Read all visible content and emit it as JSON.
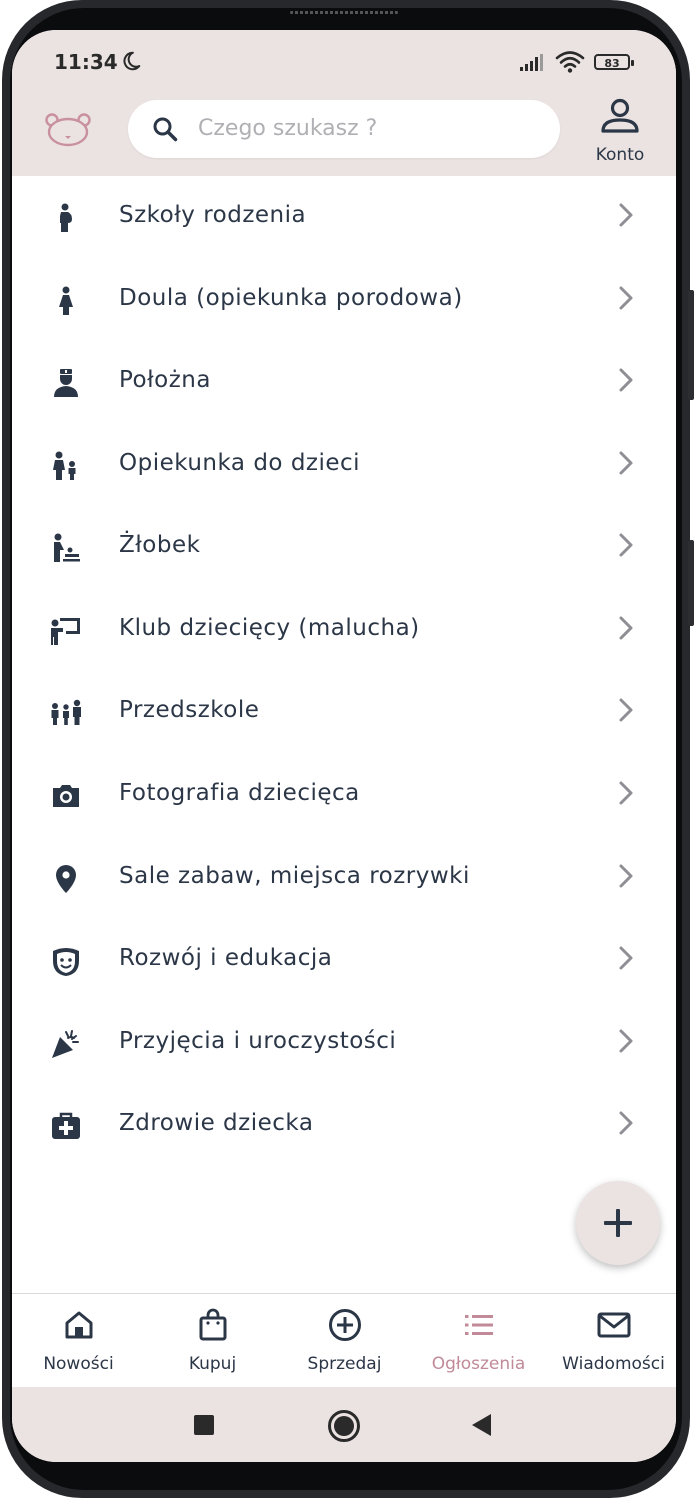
{
  "status_bar": {
    "time": "11:34",
    "battery": "83"
  },
  "header": {
    "logo_icon": "teddy-bear-icon",
    "search_placeholder": "Czego szukasz ?",
    "account_label": "Konto"
  },
  "categories": [
    {
      "label": "Szkoły rodzenia",
      "icon": "pregnant-woman-icon"
    },
    {
      "label": "Doula (opiekunka porodowa)",
      "icon": "woman-icon"
    },
    {
      "label": "Położna",
      "icon": "nurse-icon"
    },
    {
      "label": "Opiekunka do dzieci",
      "icon": "adult-child-icon"
    },
    {
      "label": "Żłobek",
      "icon": "baby-changing-icon"
    },
    {
      "label": "Klub dziecięcy (malucha)",
      "icon": "teacher-board-icon"
    },
    {
      "label": "Przedszkole",
      "icon": "family-group-icon"
    },
    {
      "label": "Fotografia dziecięca",
      "icon": "camera-icon"
    },
    {
      "label": "Sale zabaw, miejsca rozrywki",
      "icon": "map-pin-icon"
    },
    {
      "label": "Rozwój i edukacja",
      "icon": "theater-masks-icon"
    },
    {
      "label": "Przyjęcia i uroczystości",
      "icon": "party-popper-icon"
    },
    {
      "label": "Zdrowie dziecka",
      "icon": "first-aid-kit-icon"
    }
  ],
  "fab": {
    "icon": "plus-icon"
  },
  "bottom_nav": [
    {
      "label": "Nowości",
      "icon": "home-icon",
      "active": false
    },
    {
      "label": "Kupuj",
      "icon": "shopping-bag-icon",
      "active": false
    },
    {
      "label": "Sprzedaj",
      "icon": "plus-circle-icon",
      "active": false
    },
    {
      "label": "Ogłoszenia",
      "icon": "list-icon",
      "active": true
    },
    {
      "label": "Wiadomości",
      "icon": "mail-icon",
      "active": false
    }
  ],
  "colors": {
    "header_bg": "#ebe3e1",
    "text": "#2b3647",
    "accent_active": "#c08a98",
    "chevron": "#8e8e94"
  }
}
